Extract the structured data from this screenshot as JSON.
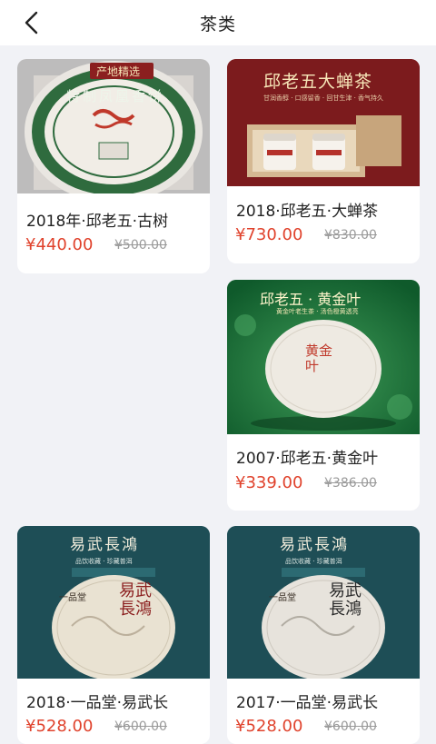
{
  "header": {
    "title": "茶类",
    "back_icon": "chevron-left-icon"
  },
  "colors": {
    "price": "#e0422c",
    "original_price": "#9a9a9a",
    "background": "#f1f2f6"
  },
  "products": [
    {
      "name": "2018年·邱老五·古树",
      "price": "¥440.00",
      "original_price": "¥500.00",
      "image_text": {
        "tag": "产地精选",
        "ring": "特制凤凰香饼"
      }
    },
    {
      "name": "2018·邱老五·大蝉茶",
      "price": "¥730.00",
      "original_price": "¥830.00",
      "image_text": {
        "banner": "邱老五大蝉茶",
        "sub": "甘润香醇 · 口感留香 · 回甘生津 · 香气持久"
      }
    },
    {
      "name": "2007·邱老五·黄金叶",
      "price": "¥339.00",
      "original_price": "¥386.00",
      "image_text": {
        "banner": "邱老五 · 黄金叶",
        "sub": "黄金叶老生茶 · 汤色橙黄透亮",
        "cake": "黄金叶"
      }
    },
    {
      "name": "2018·一品堂·易武长",
      "price": "¥528.00",
      "original_price": "¥600.00",
      "image_text": {
        "banner": "易武長鴻",
        "sub": "品饮收藏 · 珍藏普洱",
        "cake": "易武長鴻",
        "brand": "一品堂"
      }
    },
    {
      "name": "2017·一品堂·易武长",
      "price": "¥528.00",
      "original_price": "¥600.00",
      "image_text": {
        "banner": "易武長鴻",
        "sub": "品饮收藏 · 珍藏普洱",
        "cake": "易武長鴻",
        "brand": "一品堂"
      }
    }
  ]
}
